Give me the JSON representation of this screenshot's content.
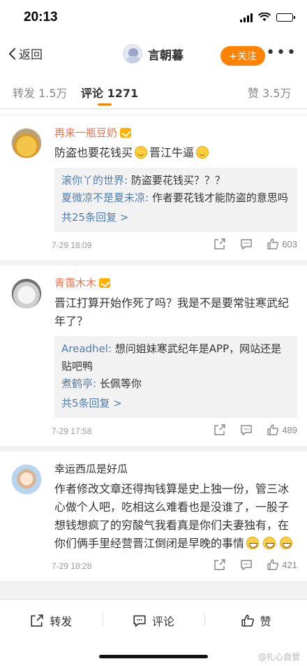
{
  "status_bar": {
    "time": "20:13"
  },
  "nav": {
    "back_label": "返回",
    "user_name": "言朝暮",
    "follow_label": "+关注",
    "more_label": "•••"
  },
  "tabs": [
    {
      "label": "转发 1.5万"
    },
    {
      "label": "评论 1271"
    },
    {
      "label": "赞 3.5万"
    }
  ],
  "comments": [
    {
      "user": "再来一瓶豆奶",
      "text_parts": [
        "防盗也要花钱买",
        "晋江牛逼"
      ],
      "emoji": [
        "smile-emoji",
        "smile-emoji"
      ],
      "replies": [
        {
          "user": "滚你丫的世界",
          "text": "防盗要花钱买？？？"
        },
        {
          "user": "夏微凉不是夏未凉",
          "text": "作者要花钱才能防盗的意思吗"
        }
      ],
      "more_replies": "共25条回复 >",
      "date": "7-29 18:09",
      "likes": "603"
    },
    {
      "user": "青霭木木",
      "text": "晋江打算开始作死了吗？我是不是要常驻寒武纪年了？",
      "replies": [
        {
          "user": "Areadhel",
          "text": "想问姐妹寒武纪年是APP，网站还是贴吧鸭"
        },
        {
          "user": "煮鹤亭",
          "text": "长佩等你"
        }
      ],
      "more_replies": "共5条回复 >",
      "date": "7-29 17:58",
      "likes": "489"
    },
    {
      "user": "幸运西瓜是好瓜",
      "text": "作者修改文章还得掏钱算是史上独一份，管三冰心做个人吧，吃相这么难看也是没谁了，一股子想钱想疯了的穷酸气我看真是你们夫妻独有，在你们俩手里经营晋江倒闭是早晚的事情",
      "emoji": [
        "grin-emoji",
        "grin-emoji",
        "grin-emoji"
      ],
      "date": "7-29 18:28",
      "likes": "421"
    }
  ],
  "bottom_bar": {
    "repost_label": "转发",
    "comment_label": "评论",
    "like_label": "赞"
  },
  "watermark": "@扎心自营",
  "colors": {
    "accent": "#ff8200",
    "link": "#507daf",
    "vip_name": "#eb7350"
  }
}
